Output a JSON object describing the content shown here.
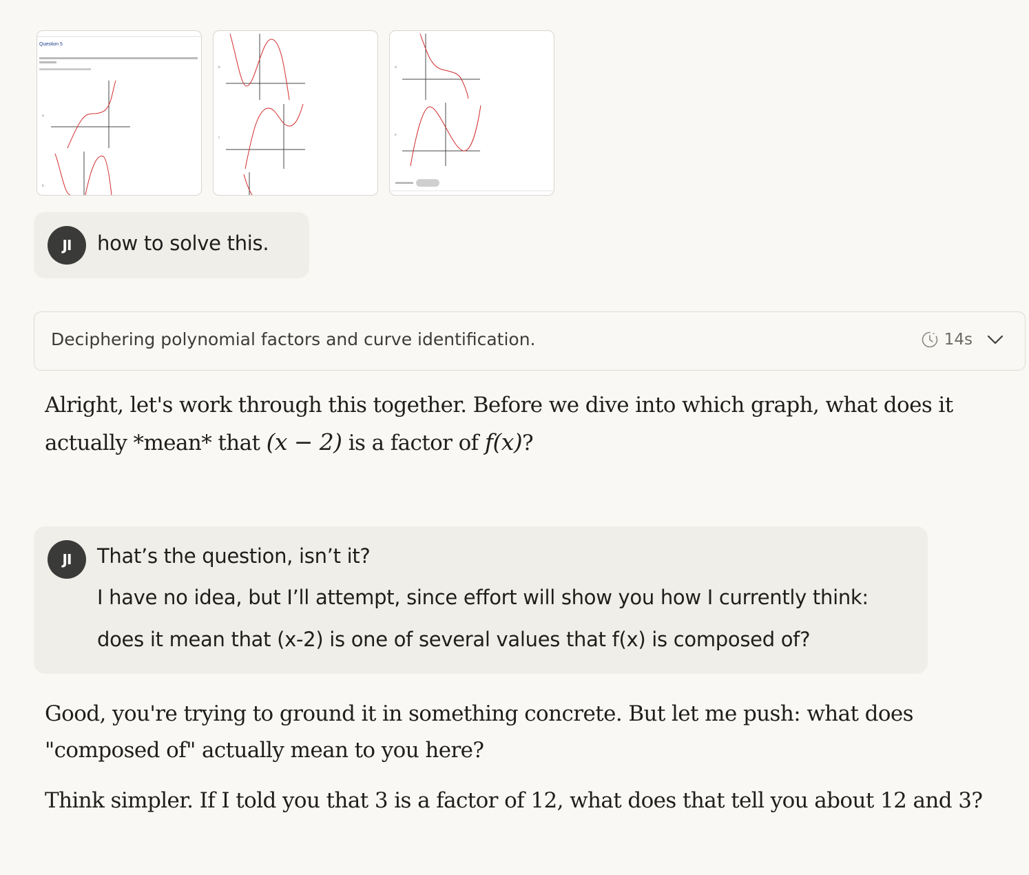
{
  "attachments": [
    {
      "label": "Question 5 screenshot part 1",
      "title": "Question 5",
      "graph_labels": [
        "a",
        "b"
      ]
    },
    {
      "label": "Question 5 screenshot part 2",
      "graph_labels": [
        "b",
        "c"
      ]
    },
    {
      "label": "Question 5 screenshot part 3",
      "graph_labels": [
        "d",
        "e"
      ]
    }
  ],
  "user_messages": [
    {
      "avatar": "JI",
      "lines": [
        "how to solve this."
      ]
    },
    {
      "avatar": "JI",
      "lines": [
        "That’s the question, isn’t it?",
        "I have no idea, but I’ll attempt, since effort will show you how I currently think:",
        "does it mean that (x-2) is one of several values that f(x) is composed of?"
      ]
    }
  ],
  "thinking": {
    "label": "Deciphering polynomial factors and curve identification.",
    "duration": "14s"
  },
  "assistant": {
    "reply1_line1": "Alright, let's work through this together. Before we dive into which graph, what does it",
    "reply1_line2_a": "actually *mean* that",
    "reply1_math1": "(x − 2)",
    "reply1_line2_b": "is a factor of",
    "reply1_math2": "f(x)",
    "reply1_line2_c": "?",
    "reply2_line1": "Good, you're trying to ground it in something concrete. But let me push: what does",
    "reply2_line2": "\"composed of\" actually mean to you here?",
    "reply3": "Think simpler. If I told you that 3 is a factor of 12, what does that tell you about 12 and 3?"
  },
  "colors": {
    "curve": "#d22b2b",
    "avatar_bg": "#3a3a38",
    "bubble_bg": "#f0eee8",
    "page_bg": "#f9f8f5"
  },
  "icons": {
    "clock": "clock-icon",
    "expand": "chevron-down-icon"
  }
}
